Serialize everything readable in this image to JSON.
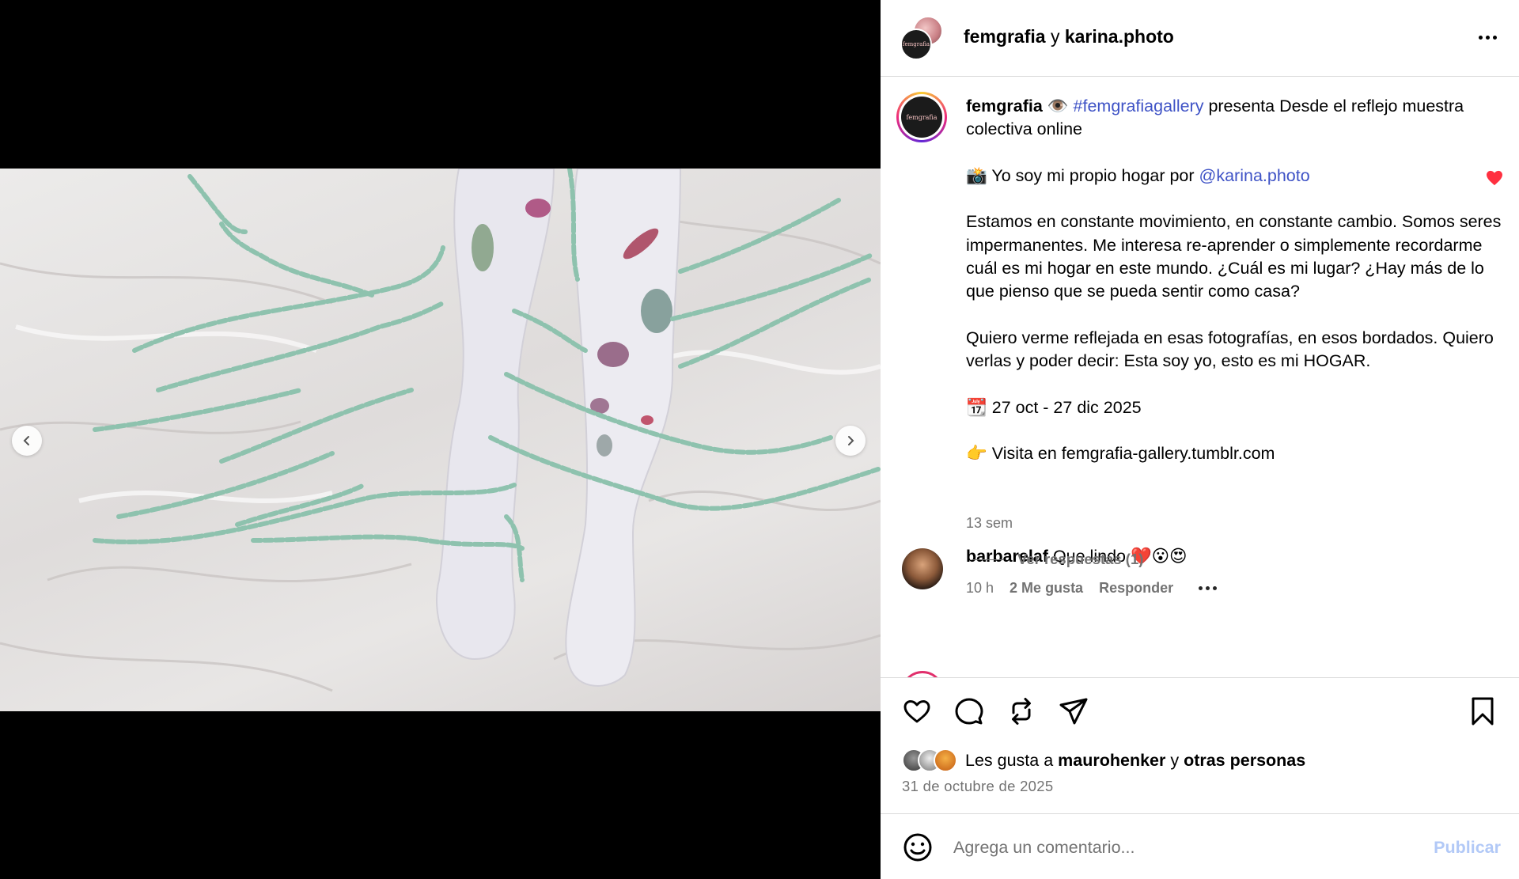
{
  "header": {
    "user1": "femgrafia",
    "conjunction": "y",
    "user2": "karina.photo",
    "avatar_text": "femgrafia"
  },
  "caption": {
    "username": "femgrafia",
    "eye_emoji": "👁️",
    "hashtag": "#femgrafiagallery",
    "line1_rest": " presenta Desde el reflejo muestra colectiva online",
    "camera_emoji": "📸",
    "line2_text": " Yo soy mi propio hogar por ",
    "mention": "@karina.photo",
    "paragraph1": "Estamos en constante movimiento, en constante cambio. Somos seres impermanentes. Me interesa re-aprender o simplemente recordarme cuál es mi hogar en este mundo. ¿Cuál es mi lugar? ¿Hay más de lo que pienso que se pueda sentir como casa?",
    "paragraph2": "Quiero verme reflejada en esas fotografías, en esos bordados. Quiero verlas y poder decir: Esta soy yo, esto es mi HOGAR.",
    "calendar_emoji": "📆",
    "dates": " 27 oct - 27 dic 2025",
    "point_emoji": "👉",
    "visit": " Visita en femgrafia-gallery.tumblr.com",
    "time_ago": "13 sem"
  },
  "comment": {
    "username": "barbarelaf",
    "text": " Que lindo ❤️😮😍",
    "time": "10 h",
    "likes": "2 Me gusta",
    "reply": "Responder",
    "view_replies": "Ver respuestas (1)"
  },
  "likes": {
    "prefix": "Les gusta a ",
    "user": "maurohenker",
    "conj": " y ",
    "others": "otras personas"
  },
  "post_date": "31 de octubre de 2025",
  "composer": {
    "placeholder": "Agrega un comentario...",
    "publish": "Publicar"
  },
  "carousel": {
    "total": 3,
    "active_index": 1
  },
  "colors": {
    "link": "#3f53c6",
    "muted": "#737373",
    "heart_red": "#ff3040",
    "publish_disabled": "#b2c9f7"
  }
}
